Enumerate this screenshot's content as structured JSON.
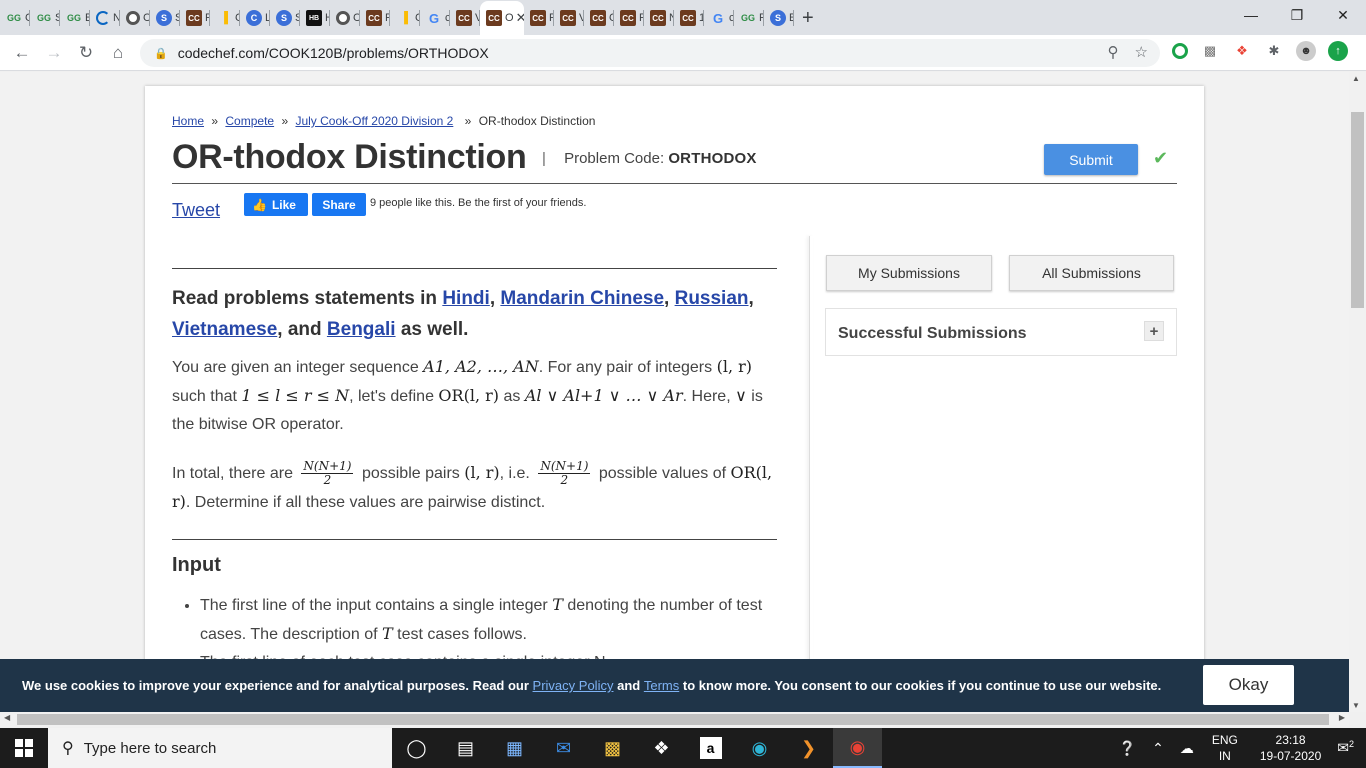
{
  "browser": {
    "tabs": [
      {
        "icon": "geeksforgeeks-icon",
        "title": "G"
      },
      {
        "icon": "geeksforgeeks-icon",
        "title": "S"
      },
      {
        "icon": "geeksforgeeks-icon",
        "title": "E"
      },
      {
        "icon": "loading-icon",
        "title": "N"
      },
      {
        "icon": "github-icon",
        "title": "C"
      },
      {
        "icon": "s-icon",
        "title": "S"
      },
      {
        "icon": "codechef-icon",
        "title": "F"
      },
      {
        "icon": "analytics-icon",
        "title": "C"
      },
      {
        "icon": "c-icon",
        "title": "L"
      },
      {
        "icon": "s-icon",
        "title": "S"
      },
      {
        "icon": "hackerrank-icon",
        "title": "H"
      },
      {
        "icon": "github-icon",
        "title": "C"
      },
      {
        "icon": "codechef-icon",
        "title": "F"
      },
      {
        "icon": "analytics-icon",
        "title": "C"
      },
      {
        "icon": "google-icon",
        "title": "c"
      },
      {
        "icon": "codechef-icon",
        "title": "V"
      },
      {
        "icon": "codechef-icon",
        "title": "O",
        "active": true
      },
      {
        "icon": "codechef-icon",
        "title": "F"
      },
      {
        "icon": "codechef-icon",
        "title": "V"
      },
      {
        "icon": "codechef-icon",
        "title": "C"
      },
      {
        "icon": "codechef-icon",
        "title": "F"
      },
      {
        "icon": "codechef-icon",
        "title": "N"
      },
      {
        "icon": "codechef-icon",
        "title": "1"
      },
      {
        "icon": "google-icon",
        "title": "c"
      },
      {
        "icon": "geeksforgeeks-icon",
        "title": "F"
      },
      {
        "icon": "s-icon",
        "title": "E"
      }
    ],
    "new_tab": "+",
    "url": "codechef.com/COOK120B/problems/ORTHODOX"
  },
  "breadcrumb": {
    "home": "Home",
    "compete": "Compete",
    "contest": "July Cook-Off 2020 Division 2",
    "current": "OR-thodox Distinction",
    "separator": "»"
  },
  "problem": {
    "title": "OR-thodox Distinction",
    "code_label": "Problem Code:",
    "code": "ORTHODOX",
    "submit_label": "Submit"
  },
  "social": {
    "tweet": "Tweet",
    "like": "Like",
    "share": "Share",
    "like_text": "9 people like this. Be the first of your friends."
  },
  "statement": {
    "lang_prefix": "Read problems statements in",
    "langs": [
      "Hindi",
      "Mandarin Chinese",
      "Russian",
      "Vietnamese",
      "Bengali"
    ],
    "lang_and": "and",
    "lang_suffix": "as well.",
    "p1_a": "You are given an integer sequence",
    "p1_seq": "A1, A2, …, AN",
    "p1_b": ". For any pair of integers",
    "p1_pair": "(l, r)",
    "p1_c": "such that",
    "p1_cond": "1 ≤ l ≤ r ≤ N",
    "p1_d": ", let's define",
    "p1_or": "OR(l, r)",
    "p1_e": "as",
    "p1_expr": "Al ∨ Al+1 ∨ … ∨ Ar",
    "p1_f": ".",
    "p1_g": "Here,",
    "p1_vee": "∨",
    "p1_h": "is the bitwise OR operator.",
    "p2_a": "In total, there are",
    "p2_frac_num": "N(N+1)",
    "p2_frac_den": "2",
    "p2_b": "possible pairs",
    "p2_pair": "(l, r)",
    "p2_c": ", i.e.",
    "p2_d": "possible values of",
    "p2_or": "OR(l, r)",
    "p2_e": ". Determine if all these values are pairwise distinct.",
    "input_heading": "Input",
    "input_1a": "The first line of the input contains a single integer",
    "input_T": "T",
    "input_1b": "denoting the number of test cases. The description of",
    "input_1c": "test cases follows.",
    "input_2": "The first line of each test case contains a single integer N."
  },
  "sidebar": {
    "my_submissions": "My Submissions",
    "all_submissions": "All Submissions",
    "successful": "Successful Submissions",
    "expand": "+"
  },
  "cookie": {
    "text_a": "We use cookies to improve your experience and for analytical purposes. Read our",
    "privacy": "Privacy Policy",
    "text_b": "and",
    "terms": "Terms",
    "text_c": "to know more. You consent to our cookies if you continue to use our website.",
    "okay": "Okay"
  },
  "taskbar": {
    "search_placeholder": "Type here to search",
    "lang_top": "ENG",
    "lang_bottom": "IN",
    "time": "23:18",
    "date": "19-07-2020",
    "notifications": "2"
  }
}
